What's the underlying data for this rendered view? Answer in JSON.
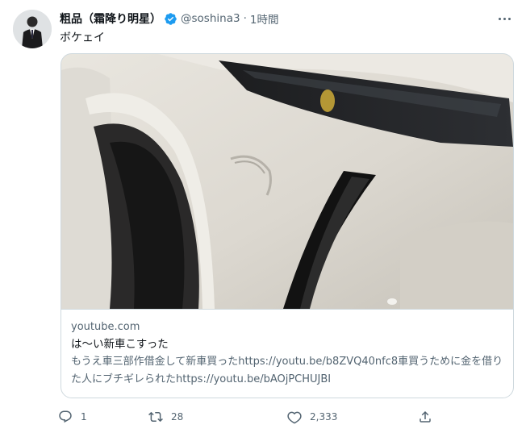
{
  "tweet": {
    "author_name": "粗品（霜降り明星）",
    "handle": "@soshina3",
    "separator": "·",
    "time": "1時間",
    "text": "ボケェイ"
  },
  "card": {
    "domain": "youtube.com",
    "title": "は〜い新車こすった",
    "description": "もうえ車三部作借金して新車買ったhttps://youtu.be/b8ZVQ40nfc8車買うために金を借りた人にブチギレられたhttps://youtu.be/bAOjPCHUJBI"
  },
  "actions": {
    "reply_count": "1",
    "retweet_count": "28",
    "like_count": "2,333"
  },
  "icons": {
    "verified": "verified-badge-icon",
    "more": "more-icon",
    "reply": "reply-icon",
    "retweet": "retweet-icon",
    "like": "heart-icon",
    "share": "share-icon"
  },
  "colors": {
    "text_primary": "#0f1419",
    "text_secondary": "#536471",
    "verified_blue": "#1d9bf0",
    "border": "#cfd9de"
  }
}
